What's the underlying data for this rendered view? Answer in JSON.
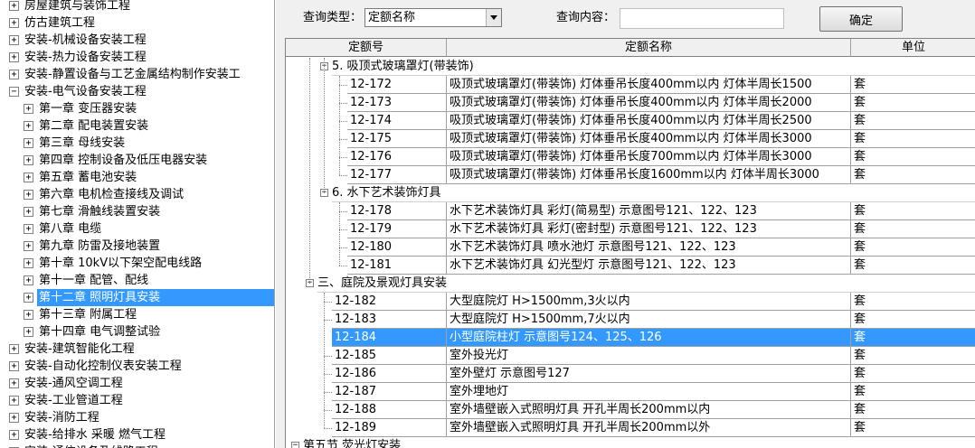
{
  "tree": [
    {
      "label": "房屋建筑与装饰工程",
      "toggle": "+",
      "level": 0
    },
    {
      "label": "仿古建筑工程",
      "toggle": "+",
      "level": 0
    },
    {
      "label": "安装-机械设备安装工程",
      "toggle": "+",
      "level": 0
    },
    {
      "label": "安装-热力设备安装工程",
      "toggle": "+",
      "level": 0
    },
    {
      "label": "安装-静置设备与工艺金属结构制作安装工",
      "toggle": "+",
      "level": 0
    },
    {
      "label": "安装-电气设备安装工程",
      "toggle": "−",
      "level": 0
    },
    {
      "label": "第一章  变压器安装",
      "toggle": "+",
      "level": 1
    },
    {
      "label": "第二章  配电装置安装",
      "toggle": "+",
      "level": 1
    },
    {
      "label": "第三章  母线安装",
      "toggle": "+",
      "level": 1
    },
    {
      "label": "第四章  控制设备及低压电器安装",
      "toggle": "+",
      "level": 1
    },
    {
      "label": "第五章  蓄电池安装",
      "toggle": "+",
      "level": 1
    },
    {
      "label": "第六章  电机检查接线及调试",
      "toggle": "+",
      "level": 1
    },
    {
      "label": "第七章  滑触线装置安装",
      "toggle": "+",
      "level": 1
    },
    {
      "label": "第八章  电缆",
      "toggle": "+",
      "level": 1
    },
    {
      "label": "第九章  防雷及接地装置",
      "toggle": "+",
      "level": 1
    },
    {
      "label": "第十章  10kV以下架空配电线路",
      "toggle": "+",
      "level": 1
    },
    {
      "label": "第十一章  配管、配线",
      "toggle": "+",
      "level": 1
    },
    {
      "label": "第十二章  照明灯具安装",
      "toggle": "+",
      "level": 1,
      "selected": true
    },
    {
      "label": "第十三章  附属工程",
      "toggle": "+",
      "level": 1
    },
    {
      "label": "第十四章  电气调整试验",
      "toggle": "+",
      "level": 1
    },
    {
      "label": "安装-建筑智能化工程",
      "toggle": "+",
      "level": 0
    },
    {
      "label": "安装-自动化控制仪表安装工程",
      "toggle": "+",
      "level": 0
    },
    {
      "label": "安装-通风空调工程",
      "toggle": "+",
      "level": 0
    },
    {
      "label": "安装-工业管道工程",
      "toggle": "+",
      "level": 0
    },
    {
      "label": "安装-消防工程",
      "toggle": "+",
      "level": 0
    },
    {
      "label": "安装-给排水  采暖  燃气工程",
      "toggle": "+",
      "level": 0
    },
    {
      "label": "安装-通信设备及线路工程",
      "toggle": "+",
      "level": 0
    }
  ],
  "query": {
    "type_label": "查询类型：",
    "type_value": "定额名称",
    "content_label": "查询内容：",
    "content_value": "",
    "confirm_label": "确定"
  },
  "grid": {
    "headers": [
      "定额号",
      "定额名称",
      "单位"
    ],
    "rows": [
      {
        "kind": "group",
        "level": 2,
        "toggle": "−",
        "label": "5. 吸顶式玻璃罩灯(带装饰)"
      },
      {
        "kind": "item",
        "level": 3,
        "code": "12-172",
        "name": "吸顶式玻璃罩灯(带装饰)  灯体垂吊长度400mm以内  灯体半周长1500",
        "unit": "套"
      },
      {
        "kind": "item",
        "level": 3,
        "code": "12-173",
        "name": "吸顶式玻璃罩灯(带装饰)  灯体垂吊长度400mm以内  灯体半周长2000",
        "unit": "套"
      },
      {
        "kind": "item",
        "level": 3,
        "code": "12-174",
        "name": "吸顶式玻璃罩灯(带装饰)  灯体垂吊长度400mm以内  灯体半周长2500",
        "unit": "套"
      },
      {
        "kind": "item",
        "level": 3,
        "code": "12-175",
        "name": "吸顶式玻璃罩灯(带装饰)  灯体垂吊长度400mm以内  灯体半周长3000",
        "unit": "套"
      },
      {
        "kind": "item",
        "level": 3,
        "code": "12-176",
        "name": "吸顶式玻璃罩灯(带装饰)  灯体垂吊长度700mm以内  灯体半周长3000",
        "unit": "套"
      },
      {
        "kind": "item",
        "level": 3,
        "code": "12-177",
        "name": "吸顶式玻璃罩灯(带装饰)  灯体垂吊长度1600mm以内  灯体半周长3000",
        "unit": "套"
      },
      {
        "kind": "group",
        "level": 2,
        "toggle": "−",
        "label": "6. 水下艺术装饰灯具"
      },
      {
        "kind": "item",
        "level": 3,
        "code": "12-178",
        "name": "水下艺术装饰灯具  彩灯(简易型)  示意图号121、122、123",
        "unit": "套"
      },
      {
        "kind": "item",
        "level": 3,
        "code": "12-179",
        "name": "水下艺术装饰灯具  彩灯(密封型)  示意图号121、122、123",
        "unit": "套"
      },
      {
        "kind": "item",
        "level": 3,
        "code": "12-180",
        "name": "水下艺术装饰灯具  喷水池灯  示意图号121、122、123",
        "unit": "套"
      },
      {
        "kind": "item",
        "level": 3,
        "code": "12-181",
        "name": "水下艺术装饰灯具  幻光型灯  示意图号121、122、123",
        "unit": "套"
      },
      {
        "kind": "group",
        "level": 1,
        "toggle": "−",
        "label": "三、庭院及景观灯具安装"
      },
      {
        "kind": "item",
        "level": 2,
        "code": "12-182",
        "name": "大型庭院灯  H>1500mm,3火以内",
        "unit": "套"
      },
      {
        "kind": "item",
        "level": 2,
        "code": "12-183",
        "name": "大型庭院灯  H>1500mm,7火以内",
        "unit": "套"
      },
      {
        "kind": "item",
        "level": 2,
        "code": "12-184",
        "name": "小型庭院柱灯  示意图号124、125、126",
        "unit": "套",
        "selected": true
      },
      {
        "kind": "item",
        "level": 2,
        "code": "12-185",
        "name": "室外投光灯",
        "unit": "套"
      },
      {
        "kind": "item",
        "level": 2,
        "code": "12-186",
        "name": "室外壁灯  示意图号127",
        "unit": "套"
      },
      {
        "kind": "item",
        "level": 2,
        "code": "12-187",
        "name": "室外埋地灯",
        "unit": "套"
      },
      {
        "kind": "item",
        "level": 2,
        "code": "12-188",
        "name": "室外墙壁嵌入式照明灯具  开孔半周长200mm以内",
        "unit": "套"
      },
      {
        "kind": "item",
        "level": 2,
        "code": "12-189",
        "name": "室外墙壁嵌入式照明灯具  开孔半周长200mm以外",
        "unit": "套"
      },
      {
        "kind": "group",
        "level": 0,
        "toggle": "−",
        "label": "第五节  荧光灯安装"
      }
    ]
  },
  "colors": {
    "selection": "#3399ff",
    "panel": "#f0f0f0"
  }
}
